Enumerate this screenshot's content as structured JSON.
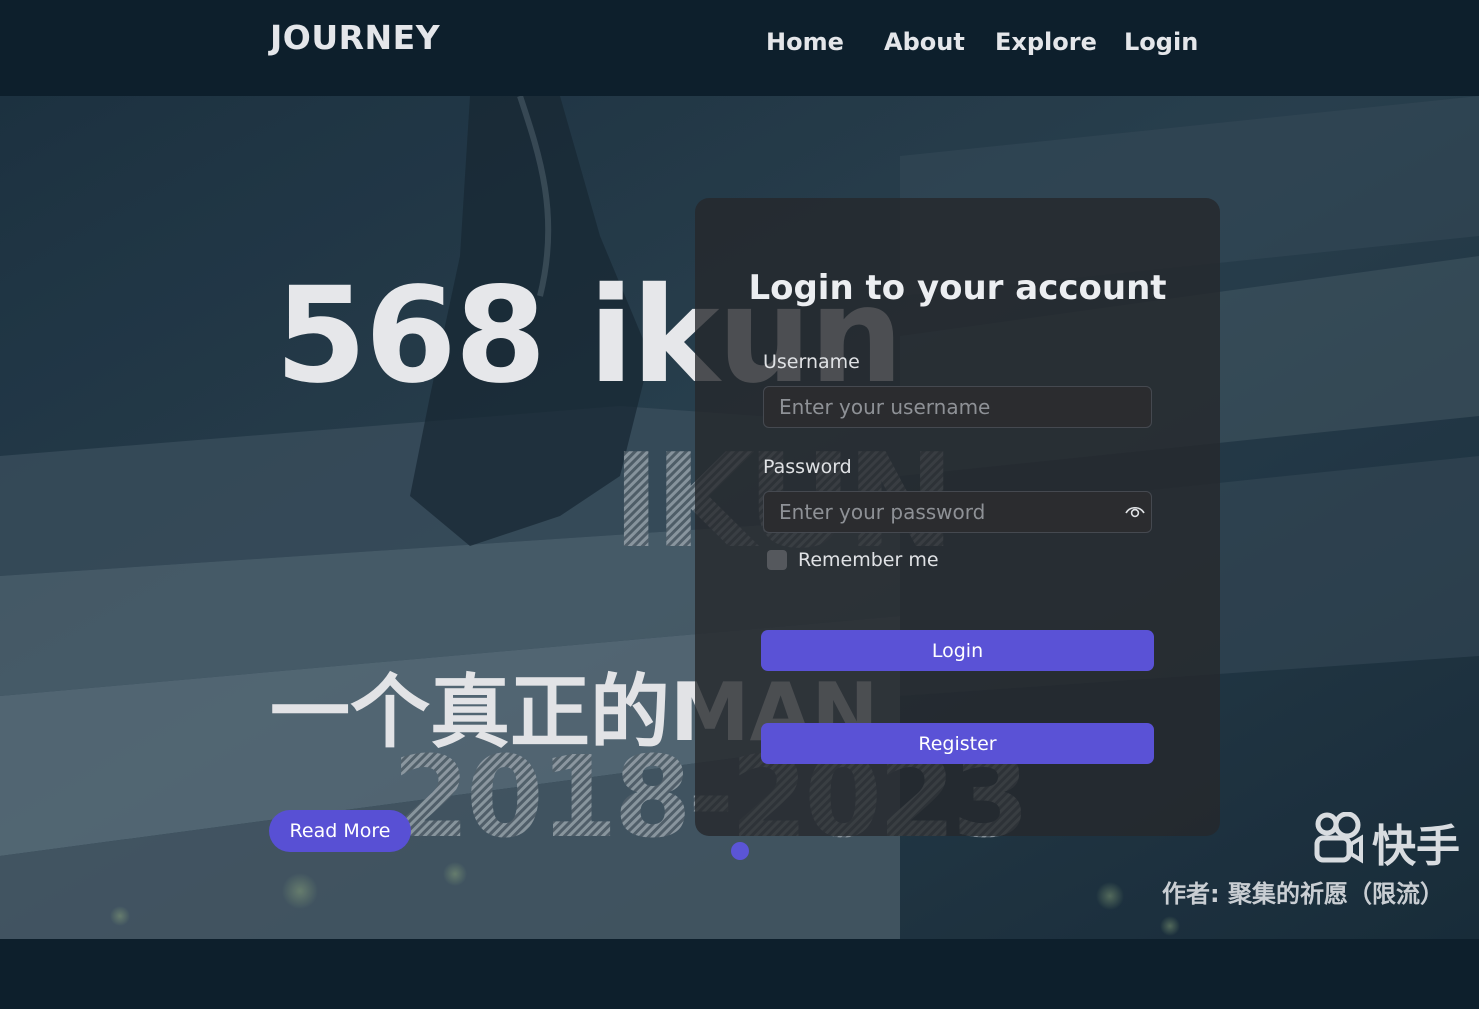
{
  "navbar": {
    "brand": "JOURNEY",
    "links": [
      "Home",
      "About",
      "Explore",
      "Login"
    ]
  },
  "hero": {
    "title": "568 ikun",
    "subtitle": "一个真正的MAN",
    "read_more_label": "Read More",
    "background_art_text": [
      "IKUN",
      "2018-2023"
    ],
    "watermark": {
      "brand": "快手",
      "author": "作者: 聚集的祈愿（限流）"
    }
  },
  "login": {
    "title": "Login to your account",
    "username_label": "Username",
    "username_placeholder": "Enter your username",
    "password_label": "Password",
    "password_placeholder": "Enter your password",
    "remember_label": "Remember me",
    "login_button": "Login",
    "register_button": "Register"
  },
  "colors": {
    "background": "#0d1f2c",
    "accent": "#5a52d6",
    "card": "#26282c",
    "text": "#e4e6ea"
  },
  "icons": {
    "password_toggle": "eye-icon",
    "watermark_logo": "kuaishou-logo-icon"
  }
}
